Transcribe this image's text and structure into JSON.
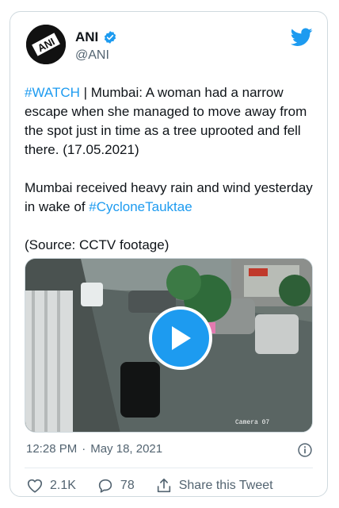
{
  "author": {
    "name": "ANI",
    "handle": "@ANI",
    "logo_text": "ANI"
  },
  "tweet": {
    "hashtag1": "#WATCH",
    "para1": " | Mumbai: A woman had a narrow escape when she managed to move away from the spot just in time as a tree uprooted and fell there. (17.05.2021)",
    "para2_prefix": "Mumbai received heavy rain and wind yesterday in wake of ",
    "hashtag2": "#CycloneTauktae",
    "para3": "(Source: CCTV footage)"
  },
  "media": {
    "camera_label": "Camera 07"
  },
  "meta": {
    "time": "12:28 PM",
    "separator": "·",
    "date": "May 18, 2021"
  },
  "actions": {
    "likes": "2.1K",
    "replies": "78",
    "share_label": "Share this Tweet"
  },
  "colors": {
    "accent": "#1d9bf0",
    "muted": "#536471",
    "text": "#0f1419"
  }
}
